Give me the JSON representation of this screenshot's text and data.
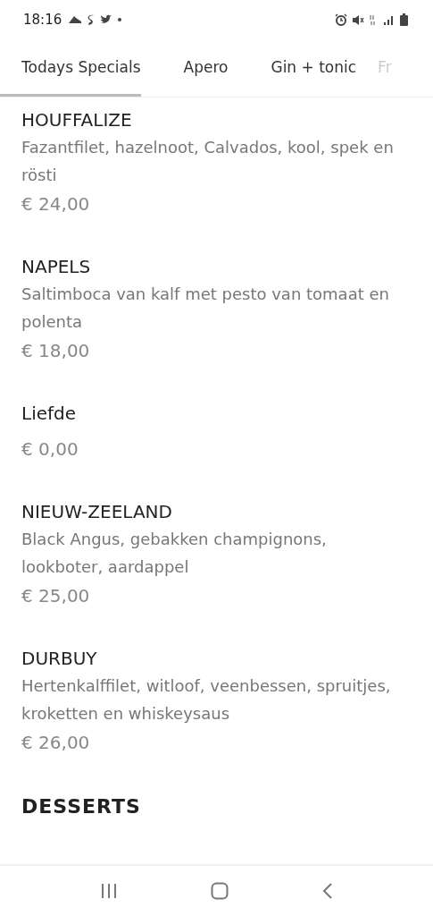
{
  "status_bar": {
    "time": "18:16"
  },
  "tabs": [
    {
      "label": "Todays Specials",
      "selected": true
    },
    {
      "label": "Apero",
      "selected": false
    },
    {
      "label": "Gin + tonic",
      "selected": false
    },
    {
      "label": "Fr",
      "selected": false
    }
  ],
  "items": [
    {
      "title": "HOUFFALIZE",
      "description": "Fazantfilet, hazelnoot, Calvados, kool, spek en rösti",
      "price": "€ 24,00"
    },
    {
      "title": "NAPELS",
      "description": "Saltimboca van kalf met pesto van tomaat en polenta",
      "price": "€ 18,00"
    },
    {
      "title": "Liefde",
      "price": "€ 0,00"
    },
    {
      "title": "NIEUW-ZEELAND",
      "description": "Black Angus, gebakken champignons, lookboter, aardappel",
      "price": "€ 25,00"
    },
    {
      "title": "DURBUY",
      "description": "Hertenkalffilet, witloof, veenbessen, spruitjes, kroketten en whiskeysaus",
      "price": "€ 26,00"
    }
  ],
  "section_heading": "DESSERTS"
}
